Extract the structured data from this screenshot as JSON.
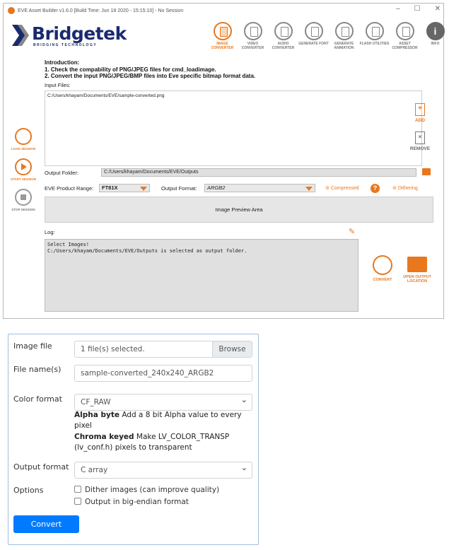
{
  "window": {
    "title": "EVE Asset Builder v1.6.0 [Build Time: Jun 18 2020 - 15:15:10] - No Session",
    "controls": [
      "–",
      "☐",
      "✕"
    ]
  },
  "logo": {
    "brand": "Bridgetek",
    "tagline": "BRIDGING TECHNOLOGY"
  },
  "toolbar": [
    {
      "label": "IMAGE CONVERTER",
      "icon": "image-converter-icon",
      "active": true
    },
    {
      "label": "VIDEO CONVERTER",
      "icon": "video-converter-icon"
    },
    {
      "label": "AUDIO CONVERTER",
      "icon": "audio-converter-icon"
    },
    {
      "label": "GENERATE FONT",
      "icon": "font-icon"
    },
    {
      "label": "GENERATE ANIMATION",
      "icon": "animation-icon"
    },
    {
      "label": "FLASH UTILITIES",
      "icon": "flash-icon"
    },
    {
      "label": "ASSET COMPRESSOR",
      "icon": "compressor-icon"
    },
    {
      "label": "INFO",
      "icon": "info-icon"
    }
  ],
  "sidebar": {
    "load": "LOAD SESSION",
    "start": "START SESSION",
    "stop": "STOP SESSION"
  },
  "intro": {
    "heading": "Introduction:",
    "line1": "1. Check the compability of PNG/JPEG files for cmd_loadimage.",
    "line2": "2. Convert the input PNG/JPEG/BMP files into Eve specific bitmap format data."
  },
  "input_files": {
    "label": "Input Files:",
    "files": "C:/Users/khayam/Documents/EVE/sample-converted.png",
    "add": "ADD",
    "remove": "REMOVE"
  },
  "output_folder": {
    "label": "Output Folder:",
    "value": "C:/Users/khayam/Documents/EVE/Outputs"
  },
  "product_range": {
    "label": "EVE Product Range:",
    "value": "FT81X"
  },
  "output_format": {
    "label": "Output Format:",
    "value": "ARGB2"
  },
  "options": {
    "compressed": "Compressed",
    "help": "?",
    "dithering": "Dithering"
  },
  "preview": "Image Preview Area",
  "log": {
    "label": "Log:",
    "text": "Select Images!\nC:/Users/khayam/Documents/EVE/Outputs is selected as output folder."
  },
  "actions": {
    "convert": "CONVERT",
    "open_output": "OPEN OUTPUT LOCATION"
  },
  "form": {
    "image_file_label": "Image file",
    "image_file_value": "1 file(s) selected.",
    "browse": "Browse",
    "file_name_label": "File name(s)",
    "file_name_value": "sample-converted_240x240_ARGB2",
    "color_format_label": "Color format",
    "color_format_value": "CF_RAW",
    "alpha_title": "Alpha byte",
    "alpha_text": "Add a 8 bit Alpha value to every pixel",
    "chroma_title": "Chroma keyed",
    "chroma_text": "Make LV_COLOR_TRANSP (lv_conf.h) pixels to transparent",
    "output_format_label": "Output format",
    "output_format_value": "C array",
    "options_label": "Options",
    "opt_dither": "Dither images (can improve quality)",
    "opt_bigendian": "Output in big-endian format",
    "convert": "Convert"
  },
  "colors": {
    "accent": "#e8771e",
    "brand": "#1a2a6e",
    "primary": "#007bff"
  }
}
